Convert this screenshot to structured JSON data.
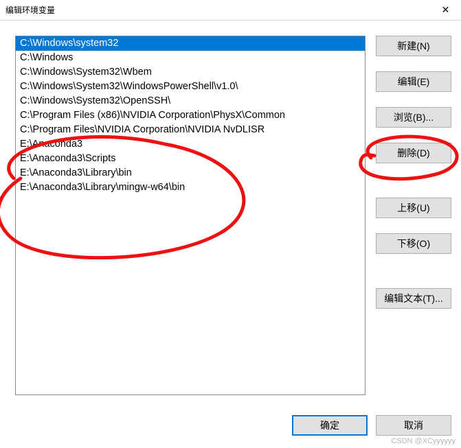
{
  "window": {
    "title": "编辑环境变量",
    "close_glyph": "✕"
  },
  "list": {
    "items": [
      "C:\\Windows\\system32",
      "C:\\Windows",
      "C:\\Windows\\System32\\Wbem",
      "C:\\Windows\\System32\\WindowsPowerShell\\v1.0\\",
      "C:\\Windows\\System32\\OpenSSH\\",
      "C:\\Program Files (x86)\\NVIDIA Corporation\\PhysX\\Common",
      "C:\\Program Files\\NVIDIA Corporation\\NVIDIA NvDLISR",
      "E:\\Anaconda3",
      "E:\\Anaconda3\\Scripts",
      "E:\\Anaconda3\\Library\\bin",
      "E:\\Anaconda3\\Library\\mingw-w64\\bin"
    ],
    "selected_index": 0
  },
  "buttons": {
    "new": "新建(N)",
    "edit": "编辑(E)",
    "browse": "浏览(B)...",
    "delete": "删除(D)",
    "move_up": "上移(U)",
    "move_down": "下移(O)",
    "edit_text": "编辑文本(T)...",
    "ok": "确定",
    "cancel": "取消"
  },
  "watermark": "CSDN @XCyyyyyy"
}
